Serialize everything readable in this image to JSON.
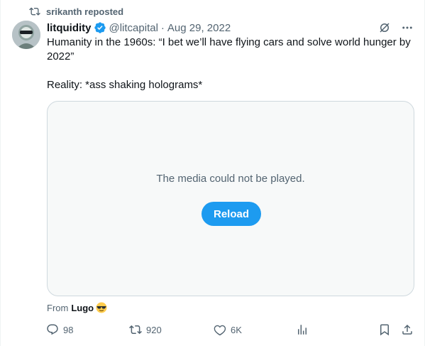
{
  "repost": {
    "label": "srikanth reposted",
    "icon": "repost-icon"
  },
  "author": {
    "name": "litquidity",
    "handle": "@litcapital",
    "separator": "·",
    "date": "Aug 29, 2022",
    "verified_color": "#1d9bf0"
  },
  "tweet": {
    "line1": "Humanity in the 1960s: “I bet we’ll have flying cars and solve world hunger by 2022”",
    "line2": "Reality: *ass shaking holograms*"
  },
  "media": {
    "message": "The media could not be played.",
    "reload_label": "Reload",
    "accent": "#1d9bf0"
  },
  "source": {
    "prefix": "From",
    "app": "Lugo"
  },
  "stats": {
    "replies": "98",
    "reposts": "920",
    "likes": "6K"
  }
}
